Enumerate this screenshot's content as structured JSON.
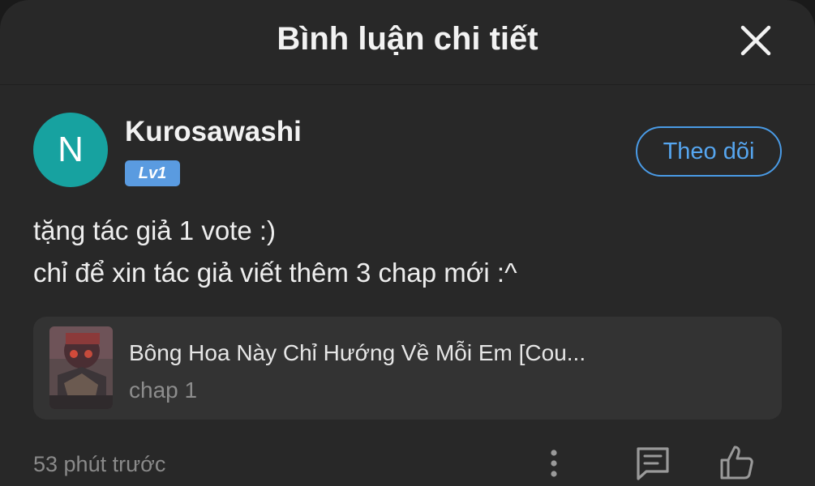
{
  "header": {
    "title": "Bình luận chi tiết",
    "close_icon": "close-icon"
  },
  "comment": {
    "avatar_letter": "N",
    "avatar_color": "#17a2a0",
    "username": "Kurosawashi",
    "level": "Lv1",
    "follow_label": "Theo dõi",
    "lines": [
      "tặng tác giả 1 vote :)",
      "chỉ để xin tác giả viết thêm 3 chap mới :^"
    ],
    "story": {
      "title": "Bông Hoa Này Chỉ Hướng Về Mỗi Em [Cou...",
      "chapter": "chap 1"
    },
    "timestamp": "53 phút trước",
    "actions": {
      "more_icon": "more-vertical-icon",
      "reply_icon": "reply-icon",
      "like_icon": "thumbs-up-icon"
    }
  },
  "colors": {
    "accent": "#4a9be6",
    "background": "#282828",
    "card": "#333333"
  }
}
